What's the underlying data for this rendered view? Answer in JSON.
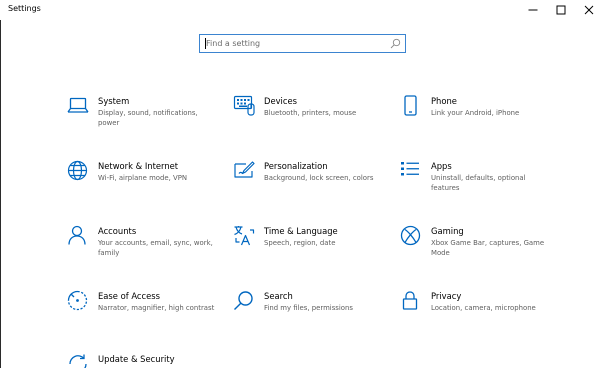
{
  "window": {
    "title": "Settings"
  },
  "search": {
    "placeholder": "Find a setting"
  },
  "accent": "#0067c0",
  "tiles": [
    {
      "label": "System",
      "desc": "Display, sound, notifications, power",
      "icon": "laptop-icon"
    },
    {
      "label": "Devices",
      "desc": "Bluetooth, printers, mouse",
      "icon": "keyboard-icon"
    },
    {
      "label": "Phone",
      "desc": "Link your Android, iPhone",
      "icon": "phone-icon"
    },
    {
      "label": "Network & Internet",
      "desc": "Wi-Fi, airplane mode, VPN",
      "icon": "globe-icon"
    },
    {
      "label": "Personalization",
      "desc": "Background, lock screen, colors",
      "icon": "paint-icon"
    },
    {
      "label": "Apps",
      "desc": "Uninstall, defaults, optional features",
      "icon": "apps-list-icon"
    },
    {
      "label": "Accounts",
      "desc": "Your accounts, email, sync, work, family",
      "icon": "person-icon"
    },
    {
      "label": "Time & Language",
      "desc": "Speech, region, date",
      "icon": "time-language-icon"
    },
    {
      "label": "Gaming",
      "desc": "Xbox Game Bar, captures, Game Mode",
      "icon": "xbox-icon"
    },
    {
      "label": "Ease of Access",
      "desc": "Narrator, magnifier, high contrast",
      "icon": "ease-of-access-icon"
    },
    {
      "label": "Search",
      "desc": "Find my files, permissions",
      "icon": "magnifier-icon"
    },
    {
      "label": "Privacy",
      "desc": "Location, camera, microphone",
      "icon": "lock-icon"
    },
    {
      "label": "Update & Security",
      "desc": "",
      "icon": "update-icon"
    }
  ]
}
